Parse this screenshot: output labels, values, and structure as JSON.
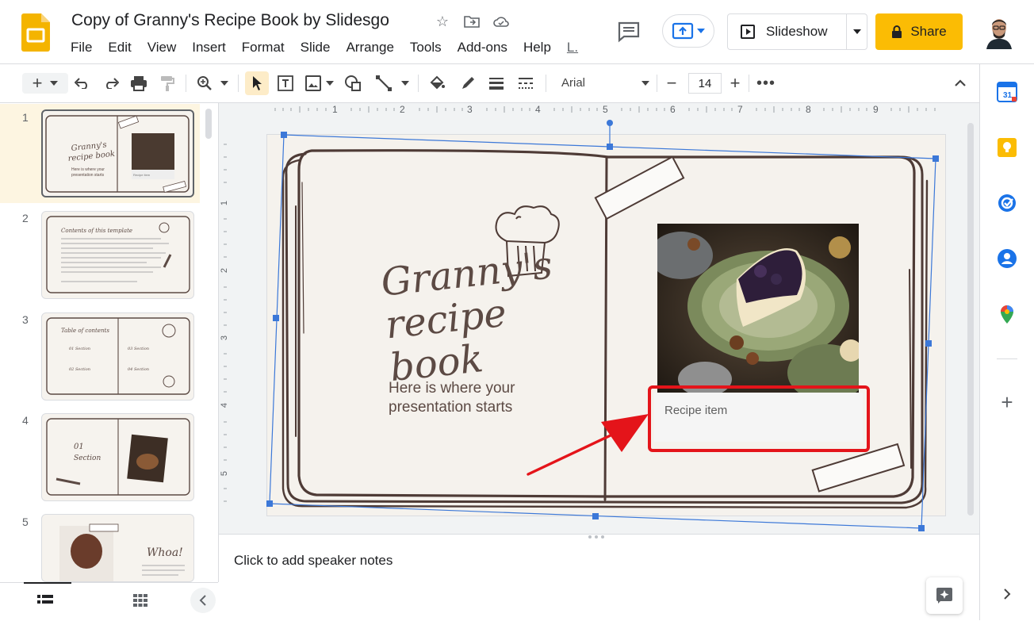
{
  "app": {
    "doc_title": "Copy of Granny's Recipe Book by Slidesgo",
    "menu": [
      "File",
      "Edit",
      "View",
      "Insert",
      "Format",
      "Slide",
      "Arrange",
      "Tools",
      "Add-ons",
      "Help",
      "L."
    ],
    "slideshow_label": "Slideshow",
    "share_label": "Share"
  },
  "toolbar": {
    "font_name": "Arial",
    "font_size": "14"
  },
  "ruler": {
    "h_ticks": [
      "1",
      "2",
      "3",
      "4",
      "5",
      "6",
      "7",
      "8",
      "9"
    ],
    "v_ticks": [
      "1",
      "2",
      "3",
      "4",
      "5"
    ]
  },
  "filmstrip": {
    "slides": [
      {
        "num": "1",
        "title": "Granny's recipe book",
        "sub": "Here is where your presentation starts",
        "caption": "Recipe item"
      },
      {
        "num": "2",
        "title": "Contents of this template"
      },
      {
        "num": "3",
        "title": "Table of contents",
        "items": [
          "01 Section",
          "02 Section",
          "03 Section",
          "04 Section"
        ]
      },
      {
        "num": "4",
        "title": "01 Section"
      },
      {
        "num": "5",
        "title": "Whoa!"
      }
    ]
  },
  "slide": {
    "title": "Granny's recipe book",
    "title_line1": "Granny's",
    "title_line2": "recipe book",
    "subtitle": "Here is where your presentation starts",
    "subtitle_line1": "Here is where your",
    "subtitle_line2": "presentation starts",
    "caption": "Recipe item"
  },
  "notes": {
    "placeholder": "Click to add speaker notes"
  },
  "colors": {
    "accent_yellow": "#fbbc04",
    "highlight_red": "#e4141a",
    "selection_blue": "#3c78d8",
    "book_brown": "#5c4a44"
  },
  "icons": {
    "side_panel": [
      "calendar-icon",
      "keep-icon",
      "tasks-icon",
      "contacts-icon",
      "maps-icon",
      "add-icon"
    ]
  }
}
